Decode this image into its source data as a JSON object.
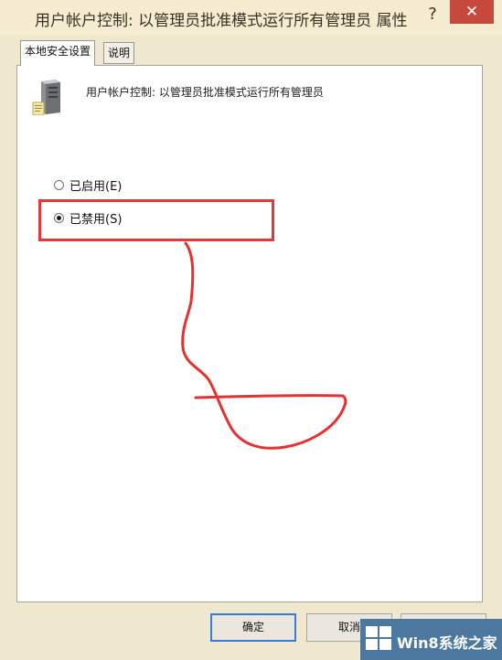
{
  "window": {
    "title": "用户帐户控制: 以管理员批准模式运行所有管理员 属性",
    "help_icon": "?",
    "close_icon": "✕"
  },
  "tabs": [
    {
      "label": "本地安全设置",
      "active": true
    },
    {
      "label": "说明",
      "active": false
    }
  ],
  "policy": {
    "icon": "server-icon",
    "label": "用户帐户控制: 以管理员批准模式运行所有管理员"
  },
  "options": {
    "enabled_label": "已启用(E)",
    "disabled_label": "已禁用(S)",
    "selected": "disabled"
  },
  "buttons": {
    "ok_label": "确定",
    "cancel_label": "取消",
    "apply_label": "应用(A)"
  },
  "watermark": {
    "text": "Win8系统之家"
  },
  "colors": {
    "annotation_red": "#e23a3a",
    "default_button_border": "#3a7bd5",
    "close_button": "#c7493d"
  }
}
